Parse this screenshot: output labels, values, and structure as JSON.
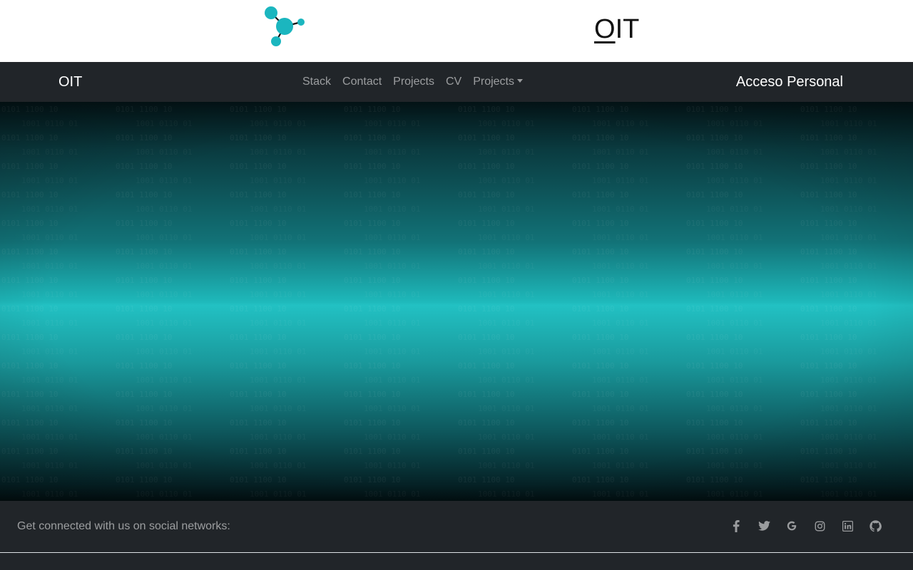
{
  "header": {
    "wordmark_first": "O",
    "wordmark_rest": "IT",
    "logo_color": "#1bb6bf"
  },
  "navbar": {
    "brand": "OIT",
    "links": [
      {
        "label": "Stack"
      },
      {
        "label": "Contact"
      },
      {
        "label": "Projects"
      },
      {
        "label": "CV"
      },
      {
        "label": "Projects",
        "dropdown": true
      }
    ],
    "access_label": "Acceso Personal"
  },
  "hero": {
    "colors": {
      "edge": "#031316",
      "center": "#22c1c3"
    }
  },
  "footer": {
    "social_text": "Get connected with us on social networks:",
    "icons": [
      "facebook-icon",
      "twitter-icon",
      "google-icon",
      "instagram-icon",
      "linkedin-icon",
      "github-icon"
    ]
  }
}
